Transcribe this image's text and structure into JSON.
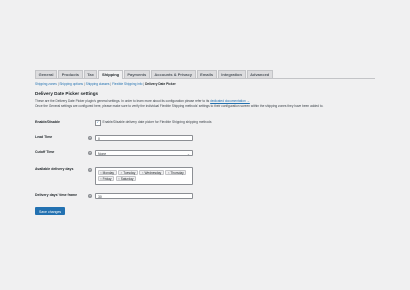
{
  "tabs": [
    {
      "label": "General"
    },
    {
      "label": "Products"
    },
    {
      "label": "Tax"
    },
    {
      "label": "Shipping",
      "active": true
    },
    {
      "label": "Payments"
    },
    {
      "label": "Accounts & Privacy"
    },
    {
      "label": "Emails"
    },
    {
      "label": "Integration"
    },
    {
      "label": "Advanced"
    }
  ],
  "subsections": {
    "links": [
      "Shipping zones",
      "Shipping options",
      "Shipping classes",
      "Flexible Shipping info"
    ],
    "separator": " | ",
    "current": "Delivery Date Picker"
  },
  "section": {
    "title": "Delivery Date Picker settings",
    "para1_text": "These are the Delivery Date Picker plugin's general settings. In order to learn more about its configuration please refer to its ",
    "para1_link": "dedicated documentation →",
    "para2_text": "Once the General settings are configured here, please make sure to verify the individual Flexible Shipping methods' settings to their configuration screen within the shipping zones they have been added to."
  },
  "fields": {
    "enable": {
      "label": "Enable/Disable",
      "checkbox_text": "Enable/Disable delivery date picker for Flexible Shipping shipping methods",
      "checked": true
    },
    "lead_time": {
      "label": "Lead Time",
      "value": "0"
    },
    "cutoff_time": {
      "label": "Cutoff Time",
      "value": "None"
    },
    "delivery_days": {
      "label": "Available delivery days",
      "chips": [
        "Monday",
        "Tuesday",
        "Wednesday",
        "Thursday",
        "Friday",
        "Saturday"
      ]
    },
    "time_frame": {
      "label": "Delivery days' time frame",
      "value": "30"
    }
  },
  "save_label": "Save changes",
  "colors": {
    "accent": "#2271b1",
    "background": "#f0f0f1"
  },
  "icons": {
    "help": "help-icon",
    "select_caret": "chevron-down-icon",
    "chip_remove": "close-icon"
  }
}
